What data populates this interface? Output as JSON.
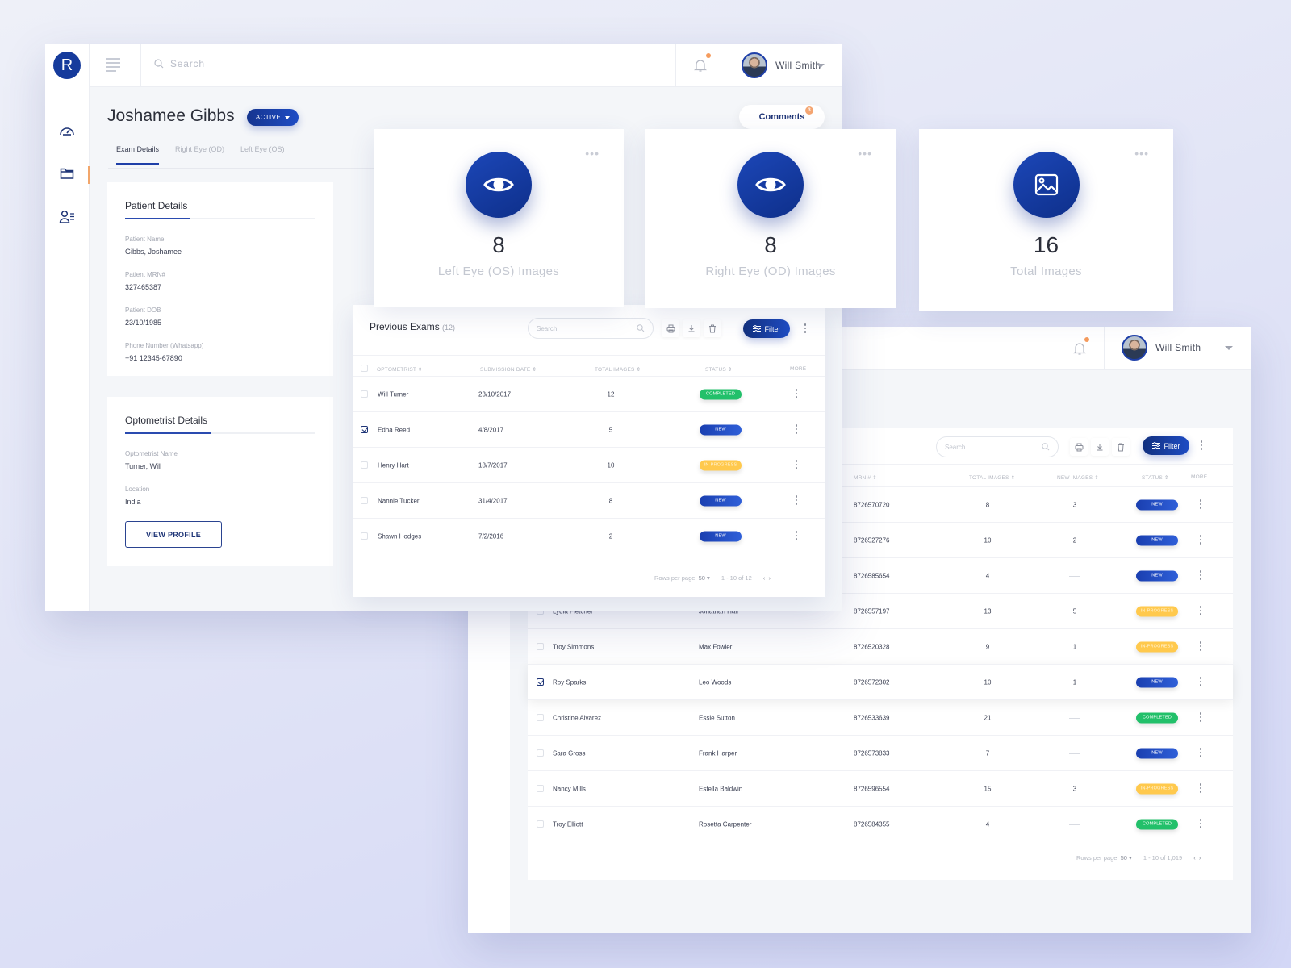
{
  "app": {
    "logo_letter": "R"
  },
  "user": {
    "name": "Will Smith"
  },
  "search": {
    "placeholder": "Search"
  },
  "sidebar": {
    "items": [
      {
        "icon": "dashboard-gauge-icon"
      },
      {
        "icon": "folder-icon",
        "active": true
      },
      {
        "icon": "user-list-icon"
      }
    ]
  },
  "patient_header": {
    "name": "Joshamee Gibbs",
    "status": "ACTIVE",
    "comments_label": "Comments",
    "comments_count": "3"
  },
  "tabs": [
    "Exam Details",
    "Right Eye (OD)",
    "Left Eye (OS)"
  ],
  "patient_details": {
    "title": "Patient Details",
    "fields": [
      {
        "label": "Patient Name",
        "value": "Gibbs, Joshamee"
      },
      {
        "label": "Patient MRN#",
        "value": "327465387"
      },
      {
        "label": "Patient DOB",
        "value": "23/10/1985"
      },
      {
        "label": "Phone Number (Whatsapp)",
        "value": "+91 12345-67890"
      }
    ]
  },
  "optometrist_details": {
    "title": "Optometrist Details",
    "fields": [
      {
        "label": "Optometrist Name",
        "value": "Turner, Will"
      },
      {
        "label": "Location",
        "value": "India"
      }
    ],
    "button": "VIEW PROFILE"
  },
  "stats": [
    {
      "value": "8",
      "label": "Left Eye (OS) Images",
      "icon": "eye-icon"
    },
    {
      "value": "8",
      "label": "Right Eye (OD) Images",
      "icon": "eye-icon"
    },
    {
      "value": "16",
      "label": "Total Images",
      "icon": "image-icon"
    }
  ],
  "previous_exams": {
    "title": "Previous Exams",
    "count": "(12)",
    "search_placeholder": "Search",
    "filter_label": "Filter",
    "columns": [
      "OPTOMETRIST ⇕",
      "SUBMISSION DATE ⇕",
      "TOTAL IMAGES ⇕",
      "STATUS ⇕",
      "MORE"
    ],
    "rows": [
      {
        "optometrist": "Will Turner",
        "date": "23/10/2017",
        "images": "12",
        "status": "COMPLETED",
        "checked": false
      },
      {
        "optometrist": "Edna Reed",
        "date": "4/8/2017",
        "images": "5",
        "status": "NEW",
        "checked": true
      },
      {
        "optometrist": "Henry Hart",
        "date": "18/7/2017",
        "images": "10",
        "status": "IN-PROGRESS",
        "checked": false
      },
      {
        "optometrist": "Nannie Tucker",
        "date": "31/4/2017",
        "images": "8",
        "status": "NEW",
        "checked": false
      },
      {
        "optometrist": "Shawn Hodges",
        "date": "7/2/2016",
        "images": "2",
        "status": "NEW",
        "checked": false
      }
    ],
    "rows_per_page_label": "Rows per page:",
    "rows_per_page": "50",
    "range": "1 - 10 of 12"
  },
  "patients_table": {
    "search_placeholder": "Search",
    "filter_label": "Filter",
    "columns": [
      "MRN # ⇕",
      "TOTAL IMAGES ⇕",
      "NEW IMAGES ⇕",
      "STATUS ⇕",
      "MORE"
    ],
    "rows": [
      {
        "patient": "",
        "optometrist": "",
        "mrn": "8726570720",
        "total": "8",
        "new": "3",
        "status": "NEW",
        "checked": false
      },
      {
        "patient": "",
        "optometrist": "",
        "mrn": "8726527276",
        "total": "10",
        "new": "2",
        "status": "NEW",
        "checked": false
      },
      {
        "patient": "",
        "optometrist": "",
        "mrn": "8726585654",
        "total": "4",
        "new": "",
        "status": "NEW",
        "checked": false
      },
      {
        "patient": "Lydia Fletcher",
        "optometrist": "Jonathan Hall",
        "mrn": "8726557197",
        "total": "13",
        "new": "5",
        "status": "IN-PROGRESS",
        "checked": false
      },
      {
        "patient": "Troy Simmons",
        "optometrist": "Max Fowler",
        "mrn": "8726520328",
        "total": "9",
        "new": "1",
        "status": "IN-PROGRESS",
        "checked": false
      },
      {
        "patient": "Roy Sparks",
        "optometrist": "Leo Woods",
        "mrn": "8726572302",
        "total": "10",
        "new": "1",
        "status": "NEW",
        "checked": true
      },
      {
        "patient": "Christine Alvarez",
        "optometrist": "Essie Sutton",
        "mrn": "8726533639",
        "total": "21",
        "new": "",
        "status": "COMPLETED",
        "checked": false
      },
      {
        "patient": "Sara Gross",
        "optometrist": "Frank Harper",
        "mrn": "8726573833",
        "total": "7",
        "new": "",
        "status": "NEW",
        "checked": false
      },
      {
        "patient": "Nancy Mills",
        "optometrist": "Estella Baldwin",
        "mrn": "8726596554",
        "total": "15",
        "new": "3",
        "status": "IN-PROGRESS",
        "checked": false
      },
      {
        "patient": "Troy Elliott",
        "optometrist": "Rosetta Carpenter",
        "mrn": "8726584355",
        "total": "4",
        "new": "",
        "status": "COMPLETED",
        "checked": false
      }
    ],
    "rows_per_page_label": "Rows per page:",
    "rows_per_page": "50",
    "range": "1 - 10 of 1,019"
  },
  "colors": {
    "primary": "#163b9c",
    "completed": "#22c06a",
    "new": "#1e4cc4",
    "in_progress": "#ffc94d",
    "notification": "#f59b5d"
  }
}
